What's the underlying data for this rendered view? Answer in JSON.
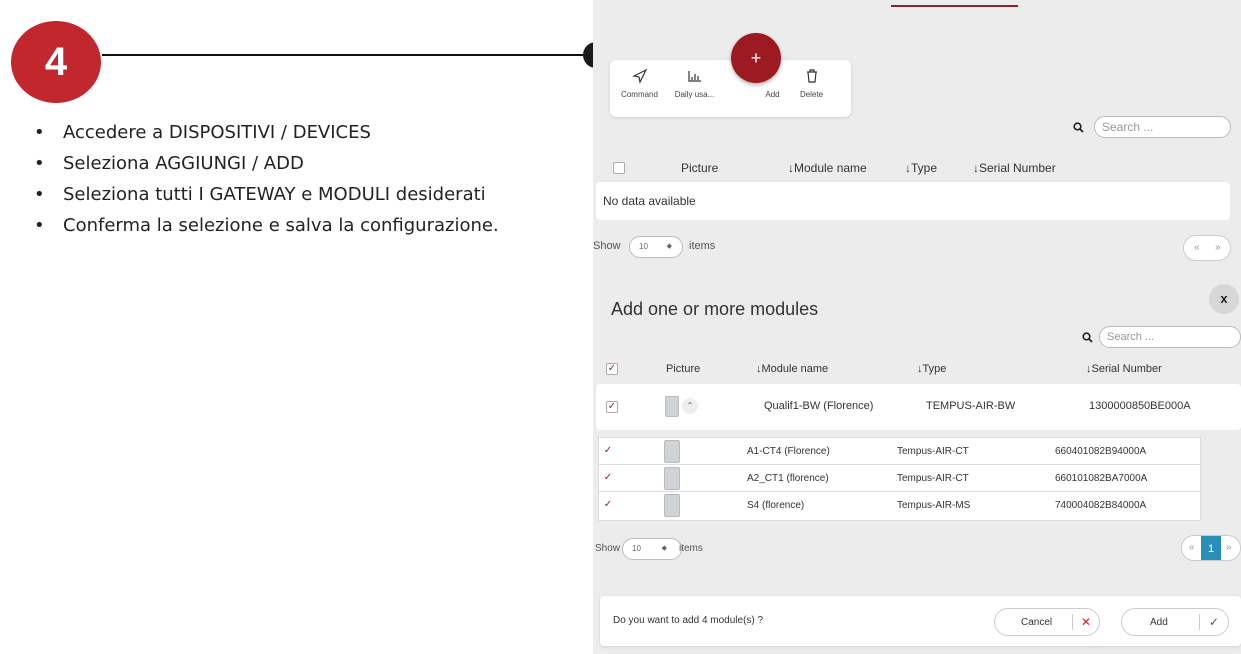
{
  "instructions": {
    "step_number": "4",
    "bullets": [
      "Accedere a DISPOSITIVI / DEVICES",
      "Seleziona AGGIUNGI / ADD",
      "Seleziona tutti I GATEWAY e MODULI desiderati",
      "Conferma la selezione e salva la configurazione."
    ]
  },
  "toolbar": {
    "command_label": "Command",
    "daily_usage_label": "Daily usa...",
    "add_label": "Add",
    "delete_label": "Delete",
    "fab_symbol": "+"
  },
  "devices_table": {
    "search_placeholder": "Search ...",
    "columns": [
      "Picture",
      "Module name",
      "Type",
      "Serial Number"
    ],
    "empty_text": "No data available",
    "show_label": "Show",
    "page_size": "10",
    "items_label": "items",
    "pager": [
      "«",
      "»"
    ]
  },
  "modal": {
    "title": "Add one or more modules",
    "close_symbol": "x",
    "search_placeholder": "Search ...",
    "columns": [
      "Picture",
      "Module name",
      "Type",
      "Serial Number"
    ],
    "gateway": {
      "name": "Qualif1-BW (Florence)",
      "type": "TEMPUS-AIR-BW",
      "serial": "1300000850BE000A",
      "checked": true
    },
    "modules": [
      {
        "name": "A1-CT4 (Florence)",
        "type": "Tempus-AIR-CT",
        "serial": "660401082B94000A",
        "checked": true
      },
      {
        "name": "A2_CT1 (florence)",
        "type": "Tempus-AIR-CT",
        "serial": "660101082BA7000A",
        "checked": true
      },
      {
        "name": "S4 (florence)",
        "type": "Tempus-AIR-MS",
        "serial": "740004082B84000A",
        "checked": true
      }
    ],
    "show_label": "Show",
    "page_size": "10",
    "items_label": "items",
    "pager": {
      "prev": "«",
      "current": "1",
      "next": "»"
    },
    "confirm_text": "Do you want to add 4 module(s) ?",
    "cancel_label": "Cancel",
    "add_label": "Add"
  },
  "colors": {
    "brand_red": "#c1272d",
    "dark_red": "#9e1a22",
    "pager_active": "#2a8fb8"
  },
  "icons": [
    "send-icon",
    "bar-chart-icon",
    "plus-icon",
    "trash-icon",
    "search-icon",
    "close-icon",
    "sort-arrow-icon",
    "chevron-up-icon",
    "checkmark-icon",
    "cross-icon"
  ]
}
